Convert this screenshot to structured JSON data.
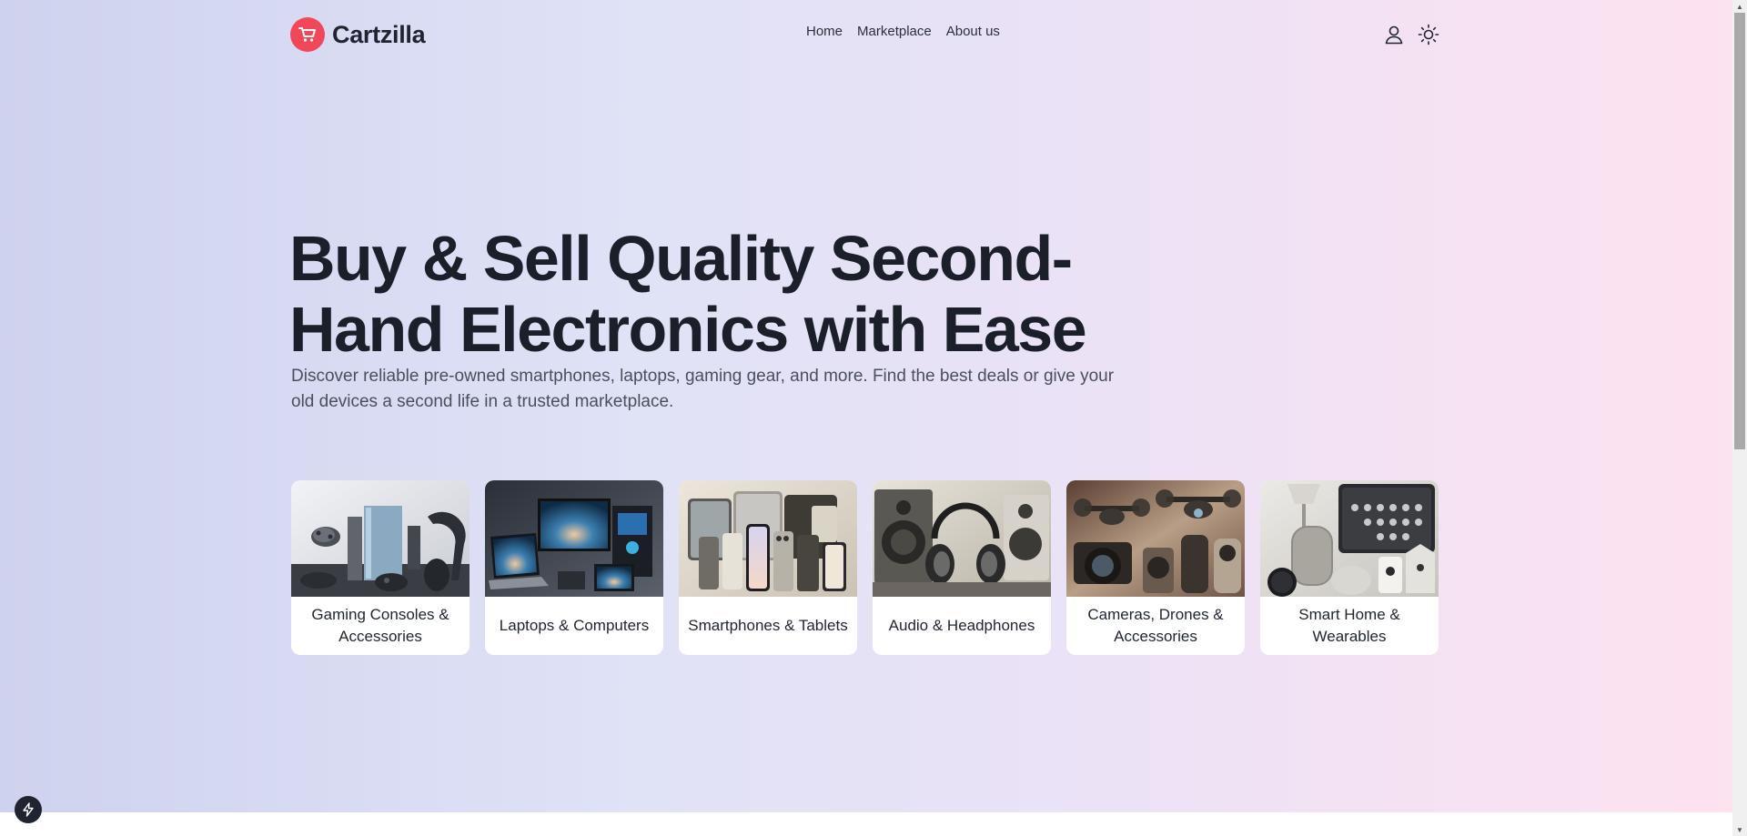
{
  "brand": {
    "name": "Cartzilla",
    "accent": "#f0475a"
  },
  "nav": {
    "items": [
      {
        "label": "Home"
      },
      {
        "label": "Marketplace"
      },
      {
        "label": "About us"
      }
    ]
  },
  "header_actions": {
    "account_icon": "user-icon",
    "theme_icon": "sun-icon"
  },
  "hero": {
    "title": "Buy & Sell Quality Second-Hand Electronics with Ease",
    "subtitle": "Discover reliable pre-owned smartphones, laptops, gaming gear, and more. Find the best deals or give your old devices a second life in a trusted marketplace."
  },
  "categories": [
    {
      "label": "Gaming Consoles & Accessories"
    },
    {
      "label": "Laptops & Computers"
    },
    {
      "label": "Smartphones & Tablets"
    },
    {
      "label": "Audio & Headphones"
    },
    {
      "label": "Cameras, Drones & Accessories"
    },
    {
      "label": "Smart Home & Wearables"
    }
  ],
  "colors": {
    "gradient_start": "#cfd2ee",
    "gradient_end": "#fde2f0",
    "text_dark": "#1b1f2a"
  }
}
